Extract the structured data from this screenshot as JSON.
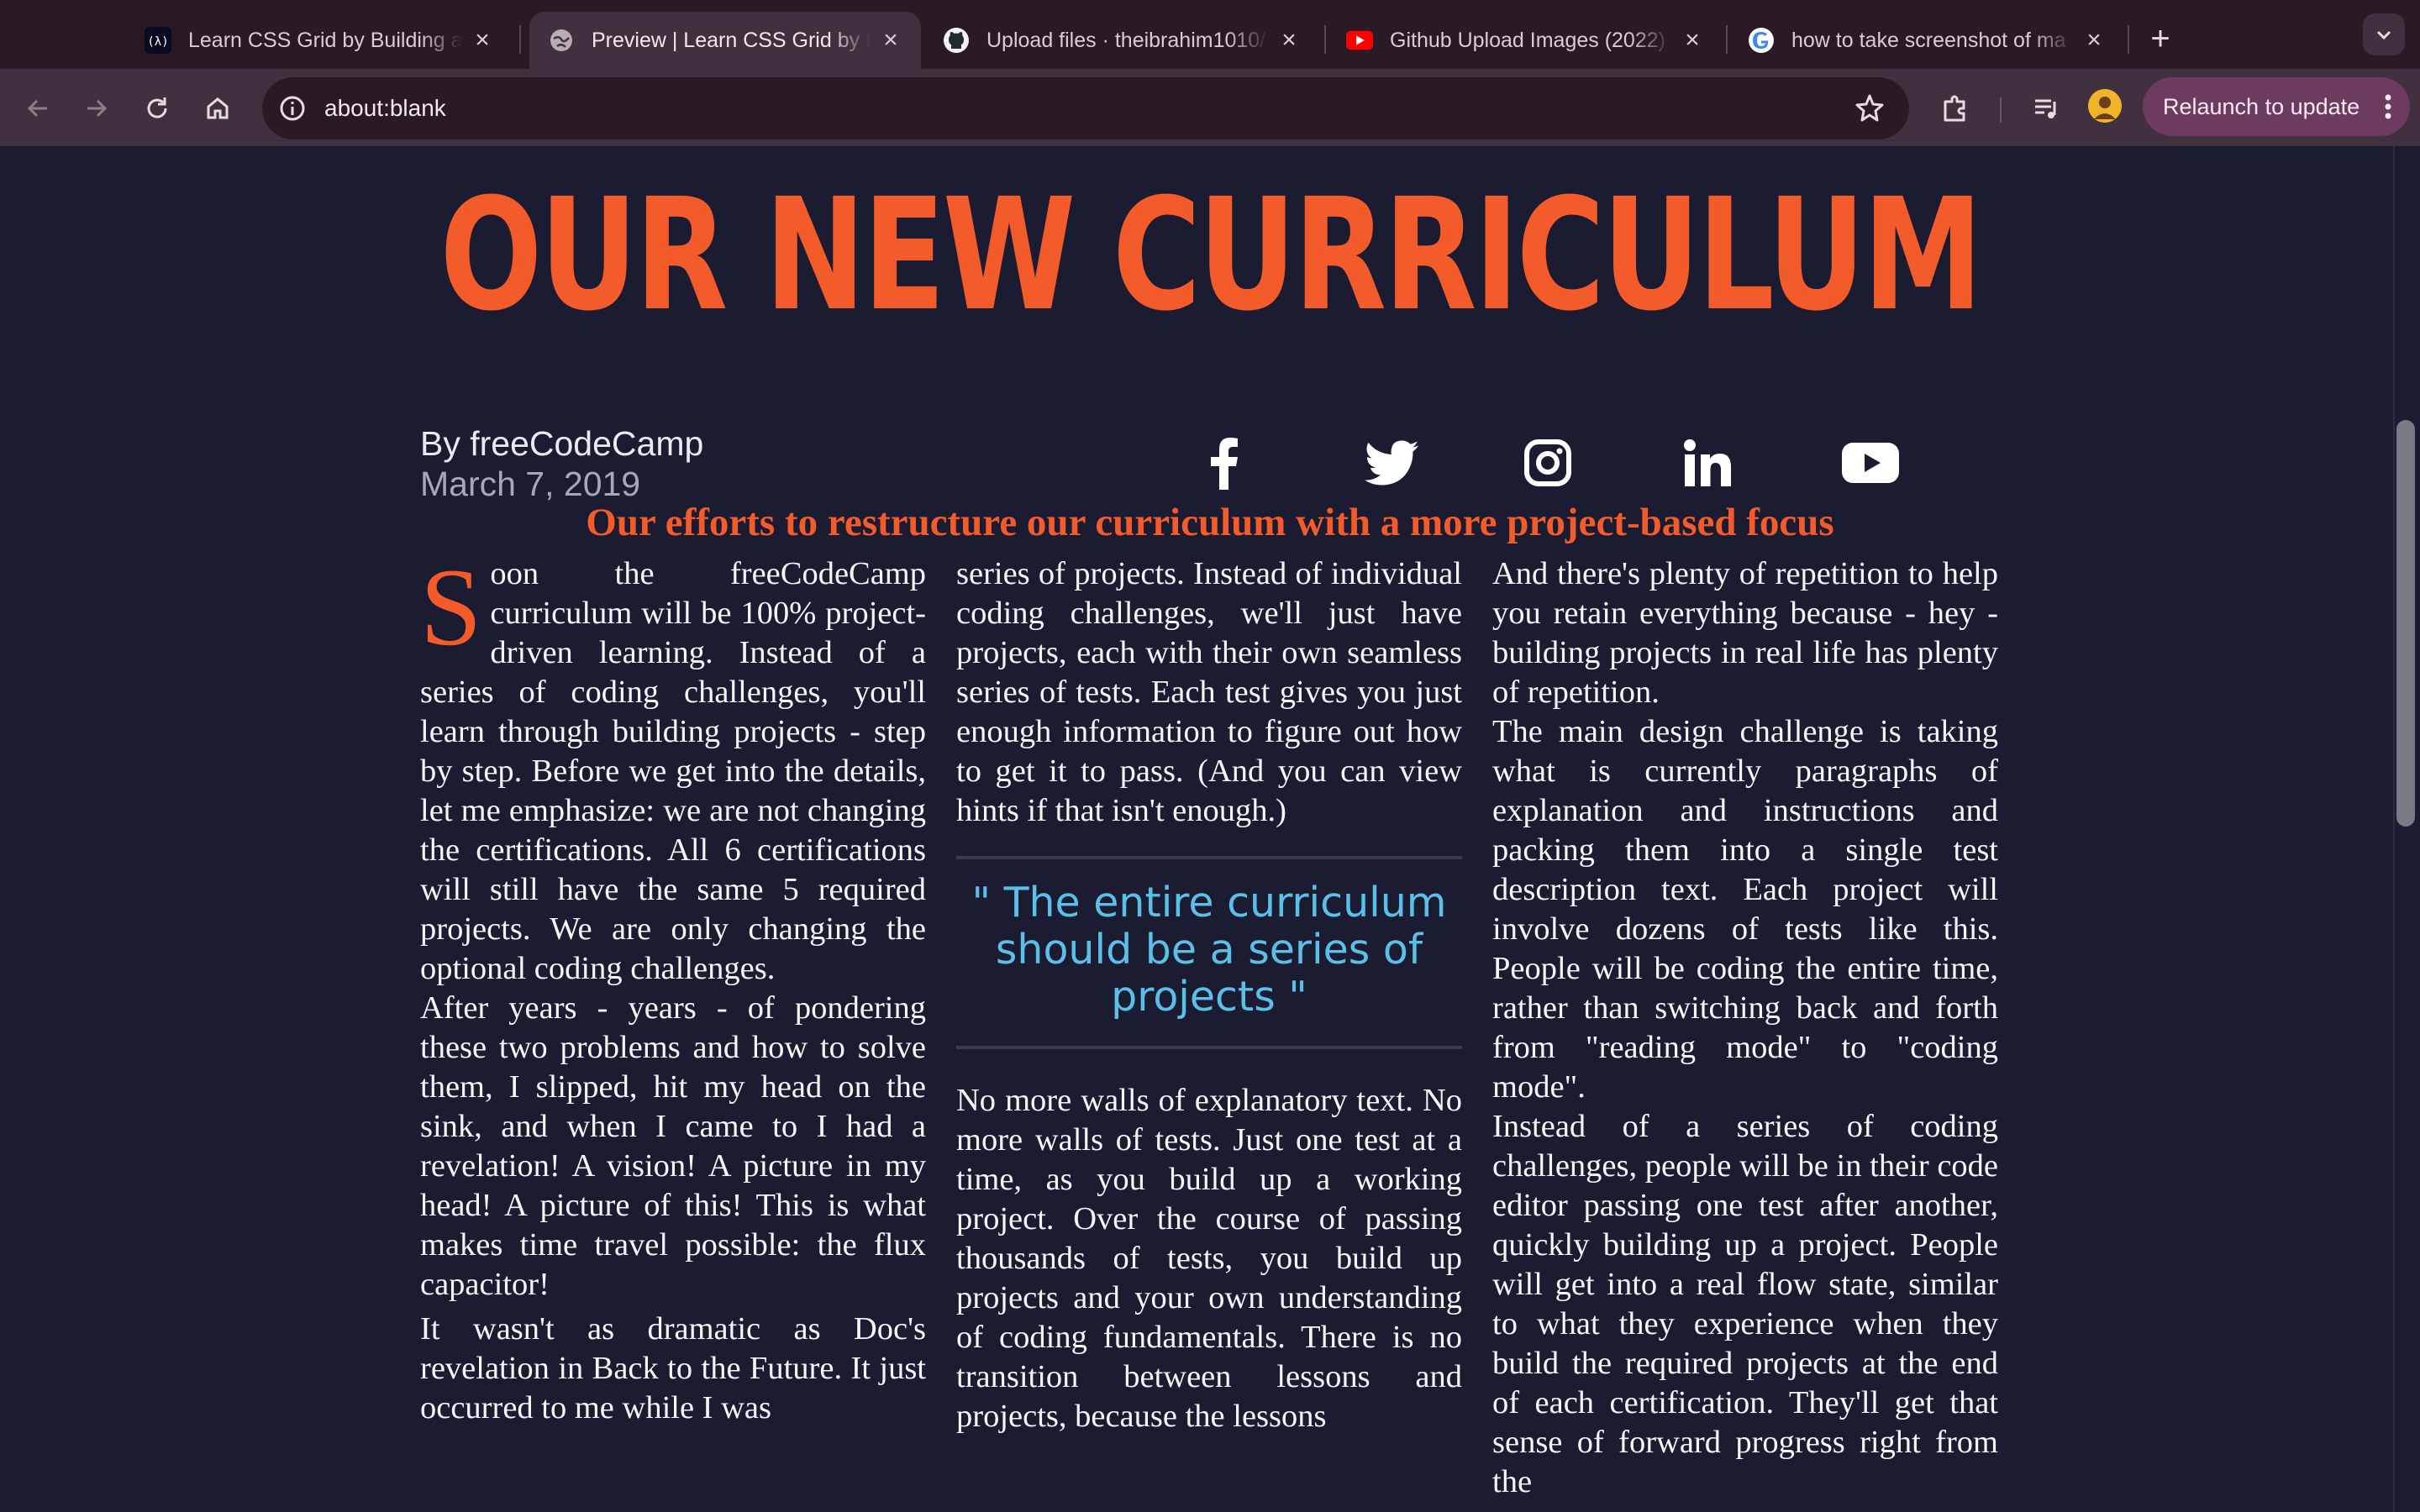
{
  "browser": {
    "tabs": [
      {
        "title": "Learn CSS Grid by Building a",
        "favicon": "freecodecamp-icon",
        "active": false
      },
      {
        "title": "Preview | Learn CSS Grid by B",
        "favicon": "globe-icon",
        "active": true
      },
      {
        "title": "Upload files · theibrahim1010/",
        "favicon": "github-icon",
        "active": false
      },
      {
        "title": "Github Upload Images (2022)",
        "favicon": "youtube-icon",
        "active": false
      },
      {
        "title": "how to take screenshot of ma",
        "favicon": "google-icon",
        "active": false
      }
    ],
    "url": "about:blank",
    "relaunch_label": "Relaunch to update"
  },
  "article": {
    "headline": "OUR NEW CURRICULUM",
    "subheadline": "Our efforts to restructure our curriculum with a more project-based focus",
    "author": "By freeCodeCamp",
    "date": "March 7, 2019",
    "social": [
      "facebook-icon",
      "twitter-icon",
      "instagram-icon",
      "linkedin-icon",
      "youtube-icon"
    ],
    "dropcap": "S",
    "col1": {
      "p1": "oon the freeCodeCamp curriculum will be 100% project-driven learning. Instead of a series of coding challenges, you'll learn through building projects - step by step. Before we get into the details, let me emphasize: we are not changing the certifications. All 6 certifications will still have the same 5 required projects. We are only changing the optional coding challenges.",
      "p2": "After years - years - of pondering these two problems and how to solve them, I slipped, hit my head on the sink, and when I came to I had a revelation! A vision! A picture in my head! A picture of this! This is what makes time travel possible: the flux capacitor!",
      "p3": "It wasn't as dramatic as Doc's revelation in Back to the Future. It just occurred to me while I was"
    },
    "col2": {
      "p1": "series of projects. Instead of individual coding challenges, we'll just have projects, each with their own seamless series of tests. Each test gives you just enough information to figure out how to get it to pass. (And you can view hints if that isn't enough.)",
      "quote": "\" The entire curriculum should be a series of projects \"",
      "p2": "No more walls of explanatory text. No more walls of tests. Just one test at a time, as you build up a working project. Over the course of passing thousands of tests, you build up projects and your own understanding of coding fundamentals. There is no transition between lessons and projects, because the lessons"
    },
    "col3": {
      "p1": "And there's plenty of repetition to help you retain everything because - hey - building projects in real life has plenty of repetition.",
      "p2": "The main design challenge is taking what is currently paragraphs of explanation and instructions and packing them into a single test description text. Each project will involve dozens of tests like this. People will be coding the entire time, rather than switching back and forth from \"reading mode\" to \"coding mode\".",
      "p3": "Instead of a series of coding challenges, people will be in their code editor passing one test after another, quickly building up a project. People will get into a real flow state, similar to what they experience when they build the required projects at the end of each certification. They'll get that sense of forward progress right from the"
    }
  },
  "colors": {
    "accent": "#f35b2b",
    "quote": "#5bc0e8",
    "background": "#1b1b32",
    "chrome": "#41303d"
  }
}
